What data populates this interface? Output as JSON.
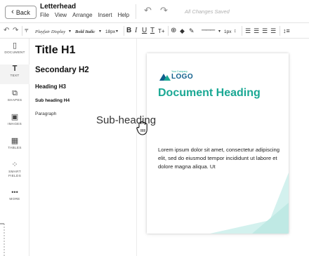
{
  "header": {
    "back_label": "Back",
    "title": "Letterhead",
    "menu": [
      "File",
      "View",
      "Arrange",
      "Insert",
      "Help"
    ],
    "save_status": "All Changes Saved"
  },
  "toolbar": {
    "font_family": "Playfair Display",
    "font_weight": "Bold Italic",
    "font_size": "18px",
    "bold": "B",
    "italic": "I",
    "underline": "U",
    "text_color": "T",
    "text_transform": "T+",
    "stroke_width": "1px"
  },
  "rail": {
    "items": [
      {
        "label": "DOCUMENT",
        "icon": "document-icon"
      },
      {
        "label": "TEXT",
        "icon": "text-icon"
      },
      {
        "label": "SHAPES",
        "icon": "shapes-icon"
      },
      {
        "label": "IMAGES",
        "icon": "image-icon"
      },
      {
        "label": "TABLES",
        "icon": "table-icon"
      },
      {
        "label": "SMART FIELDS",
        "icon": "smart-fields-icon"
      },
      {
        "label": "MORE",
        "icon": "more-icon"
      }
    ]
  },
  "text_panel": {
    "h1": "Title H1",
    "h2": "Secondary H2",
    "h3": "Heading H3",
    "h4": "Sub heading H4",
    "paragraph": "Paragraph"
  },
  "drag": {
    "label": "Sub-heading"
  },
  "document": {
    "logo_company": "Your Company",
    "logo_text": "LOGO",
    "heading": "Document Heading",
    "body": "Lorem ipsum dolor sit amet, consectetur adipiscing elit, sed do eiusmod tempor incididunt ut labore et dolore magna aliqua. Ut"
  },
  "colors": {
    "accent": "#1aa894",
    "logo_dark": "#0f5f8c",
    "corner": "#d3f1ee"
  }
}
